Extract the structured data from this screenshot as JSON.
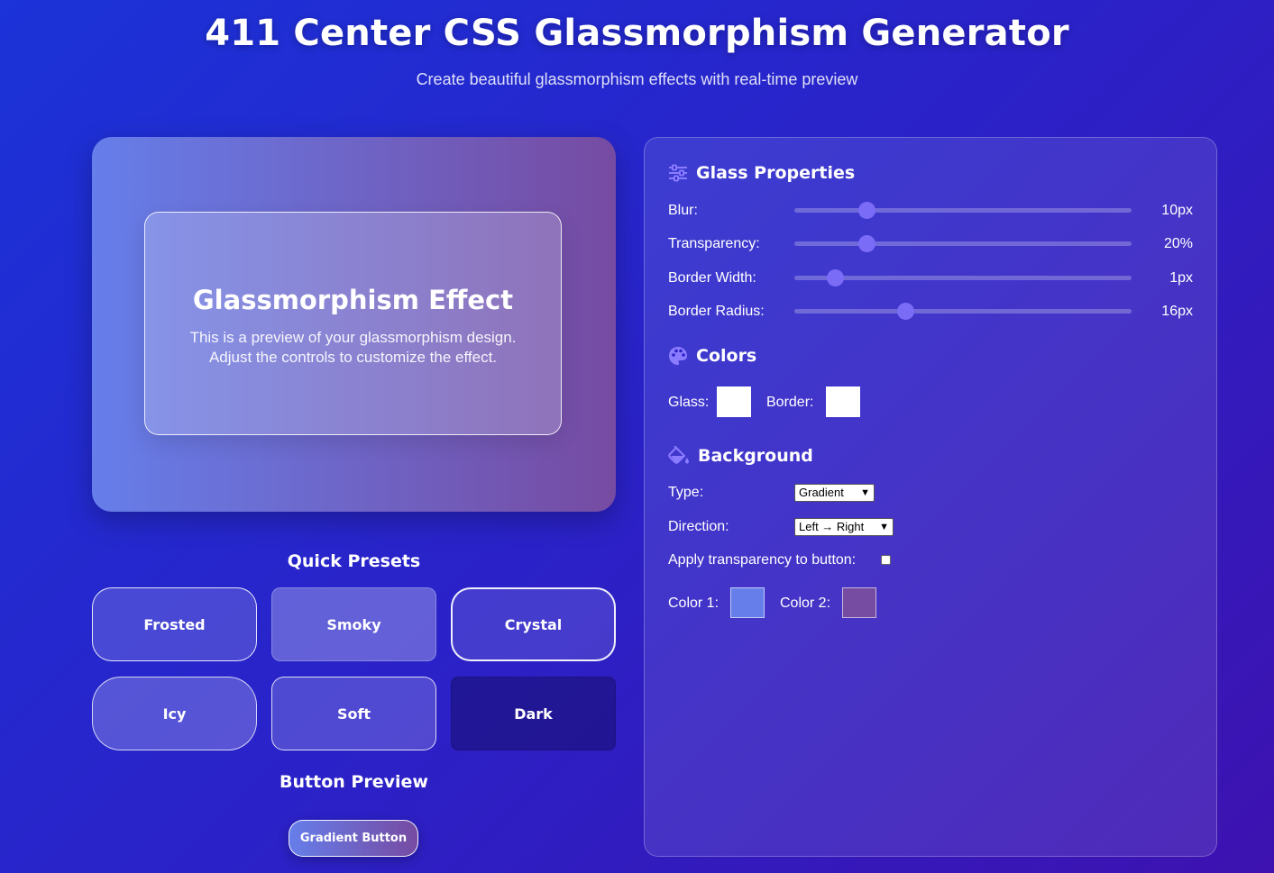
{
  "header": {
    "title": "411 Center CSS Glassmorphism Generator",
    "subtitle": "Create beautiful glassmorphism effects with real-time preview"
  },
  "preview": {
    "title": "Glassmorphism Effect",
    "text": "This is a preview of your glassmorphism design. Adjust the controls to customize the effect."
  },
  "presets": {
    "heading": "Quick Presets",
    "items": [
      "Frosted",
      "Smoky",
      "Crystal",
      "Icy",
      "Soft",
      "Dark"
    ]
  },
  "button_preview": {
    "heading": "Button Preview",
    "button_label": "Gradient Button"
  },
  "glass_properties": {
    "heading": "Glass Properties",
    "icon": "sliders-icon",
    "sliders": [
      {
        "label": "Blur:",
        "value": "10px",
        "fraction": 0.215
      },
      {
        "label": "Transparency:",
        "value": "20%",
        "fraction": 0.215
      },
      {
        "label": "Border Width:",
        "value": "1px",
        "fraction": 0.12
      },
      {
        "label": "Border Radius:",
        "value": "16px",
        "fraction": 0.33
      }
    ]
  },
  "colors": {
    "heading": "Colors",
    "icon": "palette-icon",
    "glass_label": "Glass:",
    "glass_color": "#ffffff",
    "border_label": "Border:",
    "border_color": "#ffffff"
  },
  "background": {
    "heading": "Background",
    "icon": "paint-bucket-icon",
    "type_label": "Type:",
    "type_value": "Gradient",
    "direction_label": "Direction:",
    "direction_value": "Left → Right",
    "apply_transparency_label": "Apply transparency to button:",
    "apply_transparency_checked": false,
    "color1_label": "Color 1:",
    "color1": "#667eea",
    "color2_label": "Color 2:",
    "color2": "#764ba2"
  }
}
